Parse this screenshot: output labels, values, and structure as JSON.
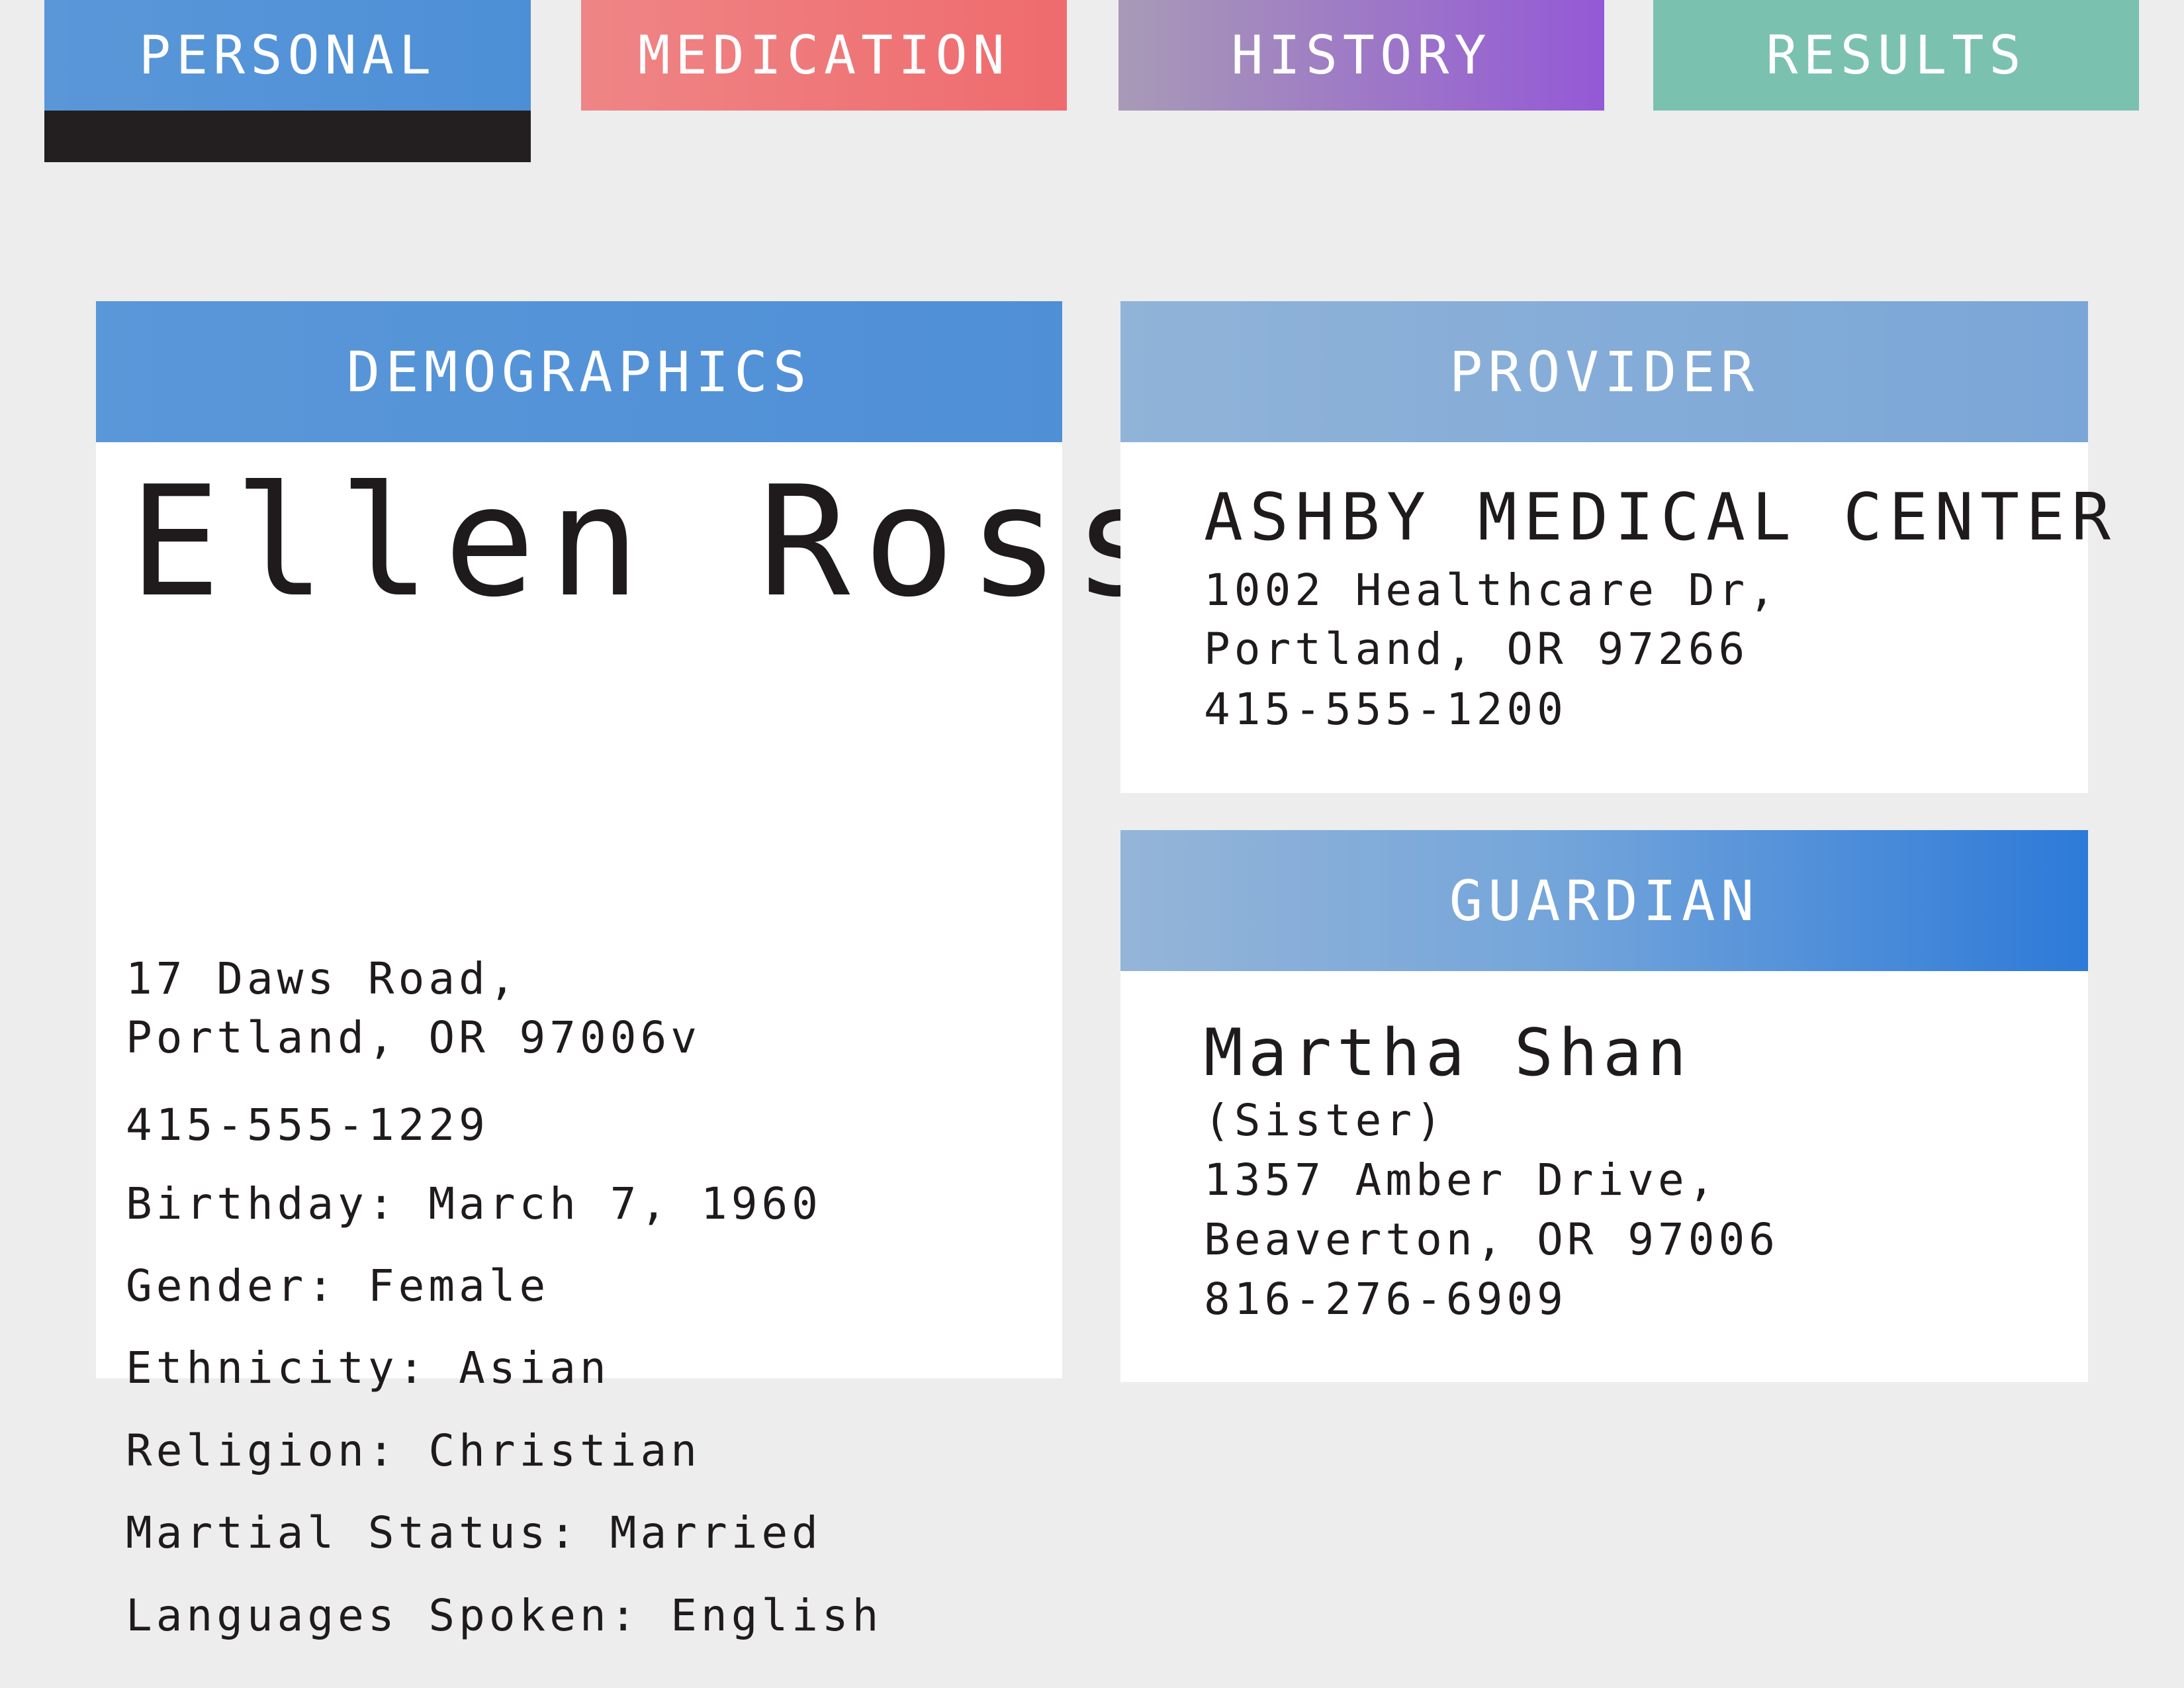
{
  "tabs": [
    {
      "label": "PERSONAL",
      "active": true
    },
    {
      "label": "MEDICATION",
      "active": false
    },
    {
      "label": "HISTORY",
      "active": false
    },
    {
      "label": "RESULTS",
      "active": false
    }
  ],
  "demographics": {
    "title": "DEMOGRAPHICS",
    "name": "Ellen Ross",
    "address_line1": "17 Daws Road,",
    "address_line2": "Portland, OR 97006v",
    "phone": "415-555-1229",
    "birthday": "Birthday: March 7, 1960",
    "gender": "Gender: Female",
    "ethnicity": "Ethnicity: Asian",
    "religion": "Religion: Christian",
    "marital_status": "Martial Status: Married",
    "languages": "Languages Spoken: English"
  },
  "provider": {
    "title": "PROVIDER",
    "name": "ASHBY MEDICAL CENTER",
    "address_line1": "1002 Healthcare Dr,",
    "address_line2": "Portland, OR 97266",
    "phone": "415-555-1200"
  },
  "guardian": {
    "title": "GUARDIAN",
    "name": "Martha Shan",
    "relation": "(Sister)",
    "address_line1": "1357 Amber Drive,",
    "address_line2": "Beaverton, OR 97006",
    "phone": "816-276-6909"
  },
  "colors": {
    "background": "#ededed",
    "personal_tab": "#4d8fd6",
    "medication_tab": "#ef6b6d",
    "history_tab": "#9459d6",
    "results_tab": "#7ac1b0",
    "active_indicator": "#231f20",
    "text": "#1f1b1c"
  }
}
